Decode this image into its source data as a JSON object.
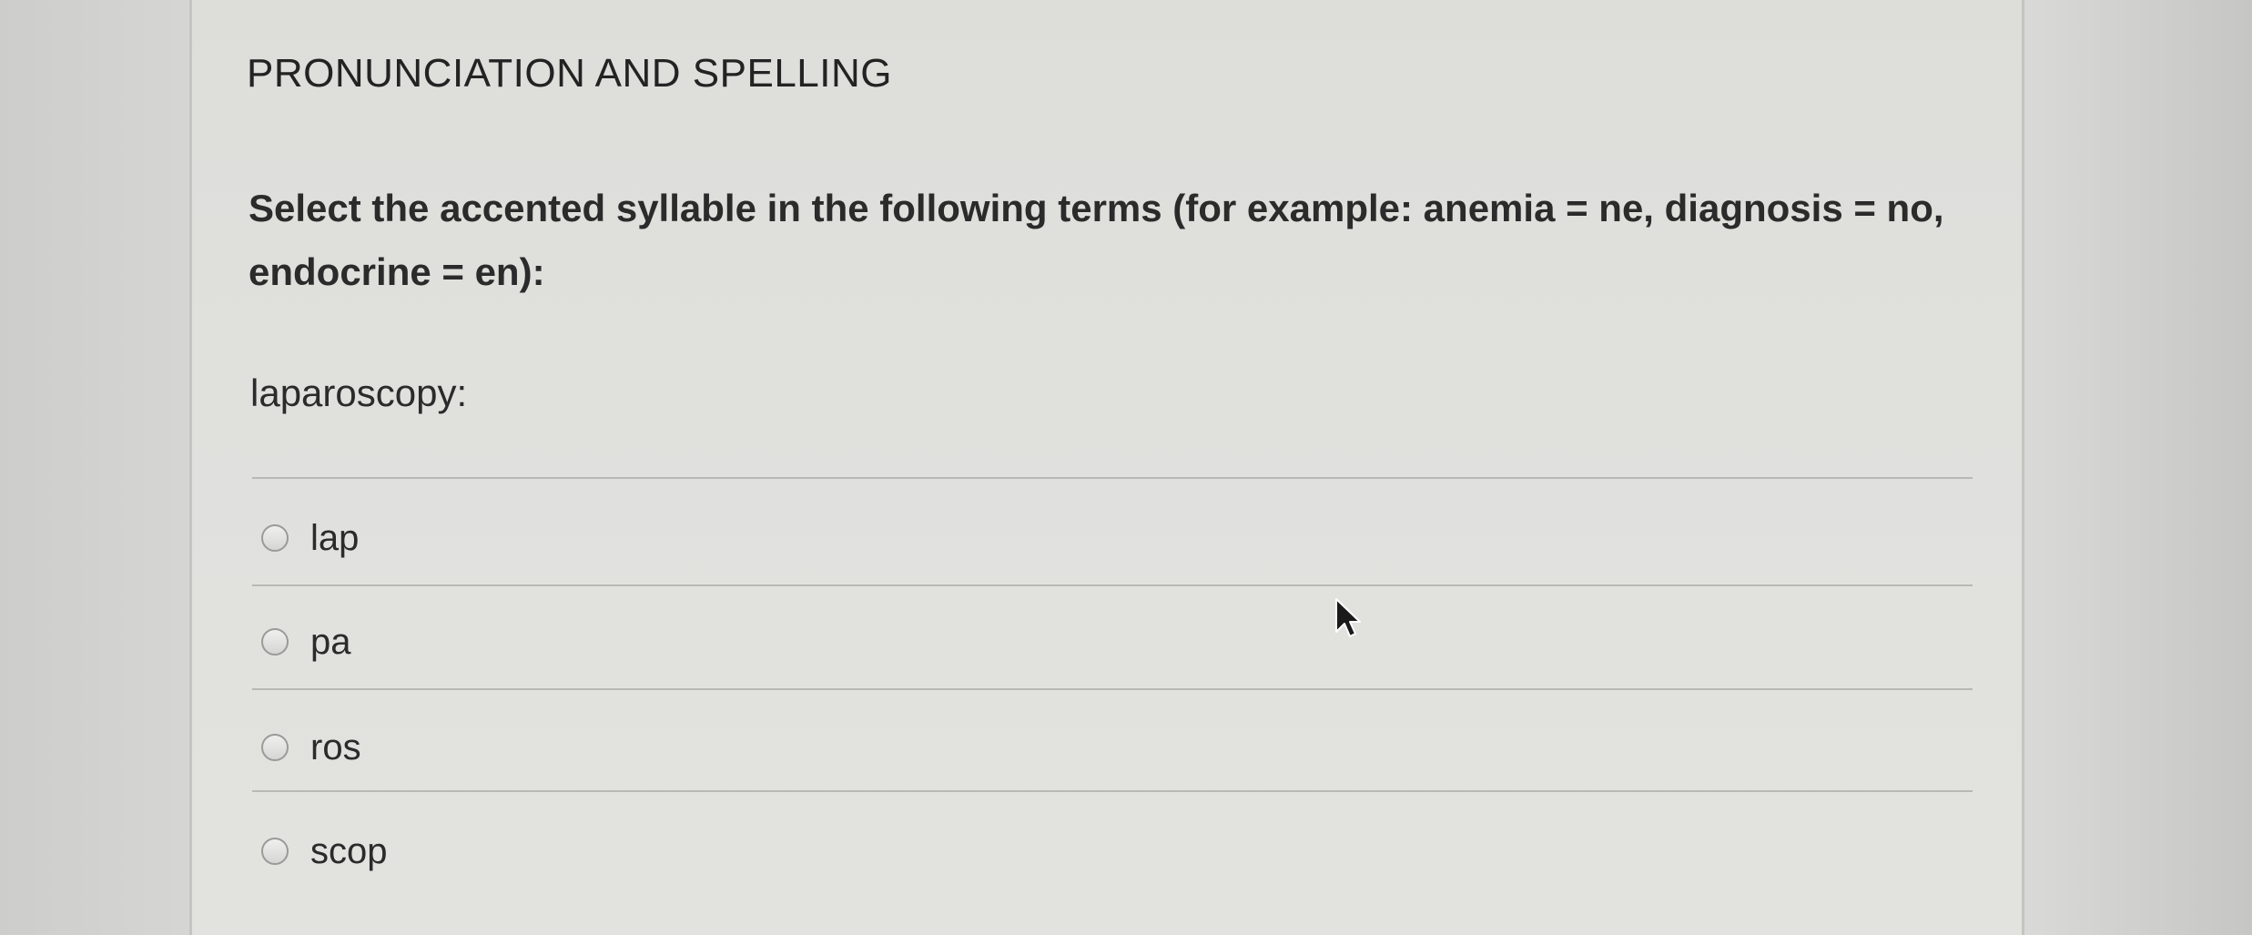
{
  "question": {
    "section_title": "PRONUNCIATION AND SPELLING",
    "prompt": "Select the accented syllable in the following terms (for example: anemia = ne, diagnosis = no, endocrine = en):",
    "term": "laparoscopy:"
  },
  "options": [
    {
      "label": "lap",
      "selected": false
    },
    {
      "label": "pa",
      "selected": false
    },
    {
      "label": "ros",
      "selected": false
    },
    {
      "label": "scop",
      "selected": false
    }
  ]
}
